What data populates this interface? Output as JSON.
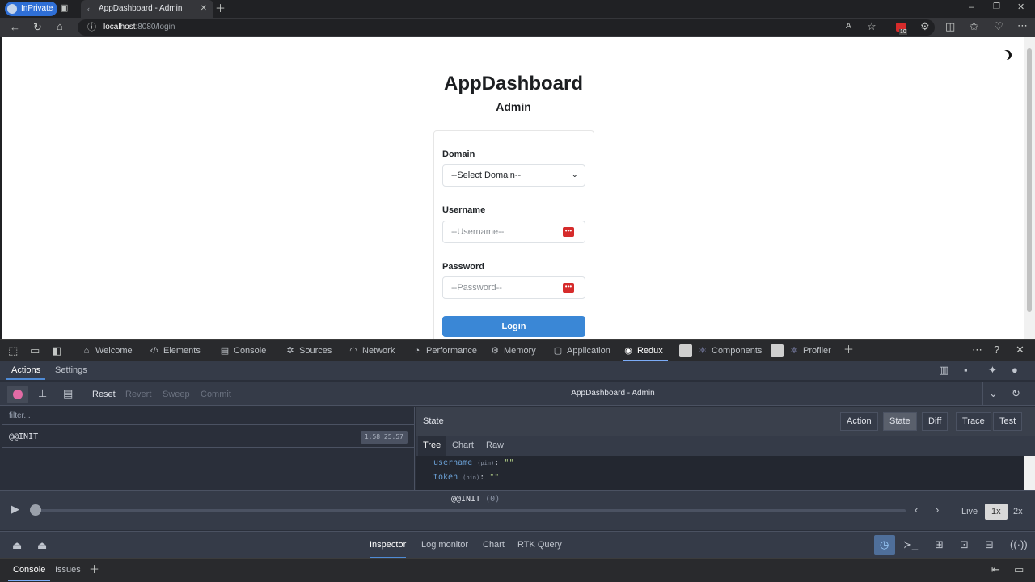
{
  "browser": {
    "inprivate_label": "InPrivate",
    "tab_title": "AppDashboard - Admin",
    "url_host": "localhost",
    "url_rest": ":8080/login",
    "badge_count": "10"
  },
  "page": {
    "title": "AppDashboard",
    "subtitle": "Admin",
    "domain_label": "Domain",
    "domain_value": "--Select Domain--",
    "username_label": "Username",
    "username_placeholder": "--Username--",
    "password_label": "Password",
    "password_placeholder": "--Password--",
    "login_label": "Login"
  },
  "devtools": {
    "tabs": [
      "Welcome",
      "Elements",
      "Console",
      "Sources",
      "Network",
      "Performance",
      "Memory",
      "Application",
      "Redux",
      "Components",
      "Profiler"
    ],
    "active_tab": "Redux"
  },
  "redux": {
    "top_tabs": [
      "Actions",
      "Settings"
    ],
    "buttons": [
      "Reset",
      "Revert",
      "Sweep",
      "Commit"
    ],
    "instance": "AppDashboard - Admin",
    "filter_placeholder": "filter...",
    "action_name": "@@INIT",
    "action_time": "1:58:25.57",
    "panel_title": "State",
    "panel_tabs": [
      "Action",
      "State",
      "Diff",
      "Trace",
      "Test"
    ],
    "panel_active": "State",
    "sub_tabs": [
      "Tree",
      "Chart",
      "Raw"
    ],
    "tree": [
      {
        "key": "username",
        "pin": "(pin)",
        "value": "\"\""
      },
      {
        "key": "token",
        "pin": "(pin)",
        "value": "\"\""
      }
    ],
    "slider_label": "@@INIT",
    "slider_count": "(0)",
    "speed": [
      "Live",
      "1x",
      "2x"
    ],
    "monitors": [
      "Inspector",
      "Log monitor",
      "Chart",
      "RTK Query"
    ],
    "active_monitor": "Inspector"
  },
  "console_bar": {
    "tabs": [
      "Console",
      "Issues"
    ]
  }
}
